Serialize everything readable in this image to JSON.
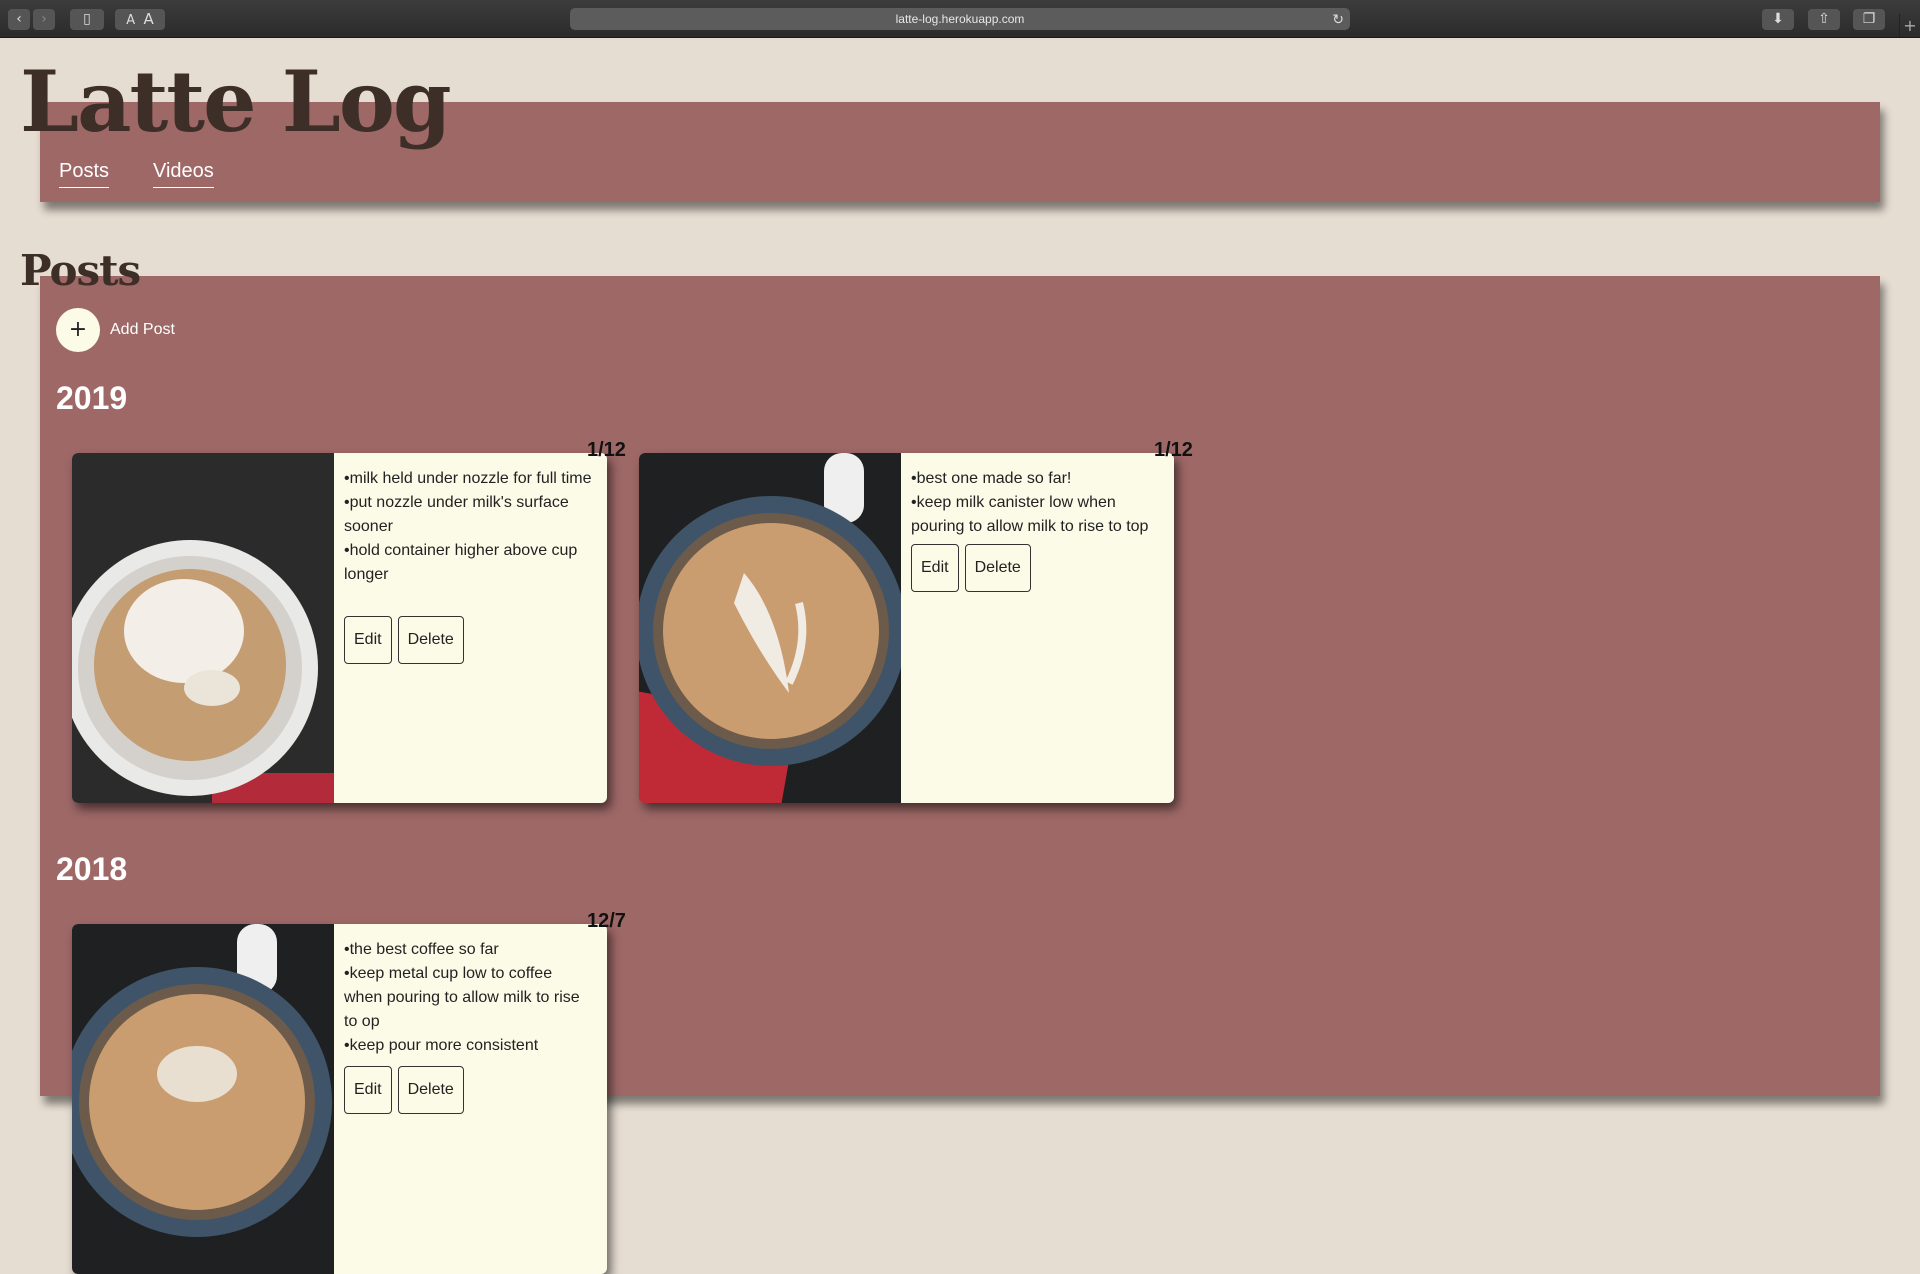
{
  "browser": {
    "url": "latte-log.herokuapp.com",
    "back_icon": "chevron-left-icon",
    "forward_icon": "chevron-right-icon",
    "sidebar_icon": "sidebar-icon",
    "text_smaller": "A",
    "text_larger": "A",
    "reload_icon": "reload-icon",
    "download_icon": "download-icon",
    "share_icon": "share-icon",
    "tabs_icon": "tabs-icon",
    "new_tab_label": "+"
  },
  "site": {
    "title": "Latte Log",
    "nav": [
      "Posts",
      "Videos"
    ]
  },
  "posts_section": {
    "title": "Posts",
    "add_label": "Add Post",
    "add_icon": "+"
  },
  "years": [
    {
      "year": "2019",
      "posts": [
        {
          "date": "1/12",
          "notes": [
            "milk held under nozzle for full time",
            "put nozzle under milk's surface sooner",
            "hold container higher above cup longer"
          ],
          "edit": "Edit",
          "delete": "Delete"
        },
        {
          "date": "1/12",
          "notes": [
            "best one made so far!",
            "keep milk canister low when pouring to allow milk to rise to top"
          ],
          "edit": "Edit",
          "delete": "Delete"
        }
      ]
    },
    {
      "year": "2018",
      "posts": [
        {
          "date": "12/7",
          "notes": [
            "the best coffee so far",
            "keep metal cup low to coffee when pouring to allow milk to rise to op",
            "keep pour more consistent"
          ],
          "edit": "Edit",
          "delete": "Delete"
        }
      ]
    }
  ],
  "colors": {
    "background": "#e6ddd2",
    "panel": "#9e6867",
    "card": "#fcfbe8",
    "title": "#3d2f28"
  }
}
